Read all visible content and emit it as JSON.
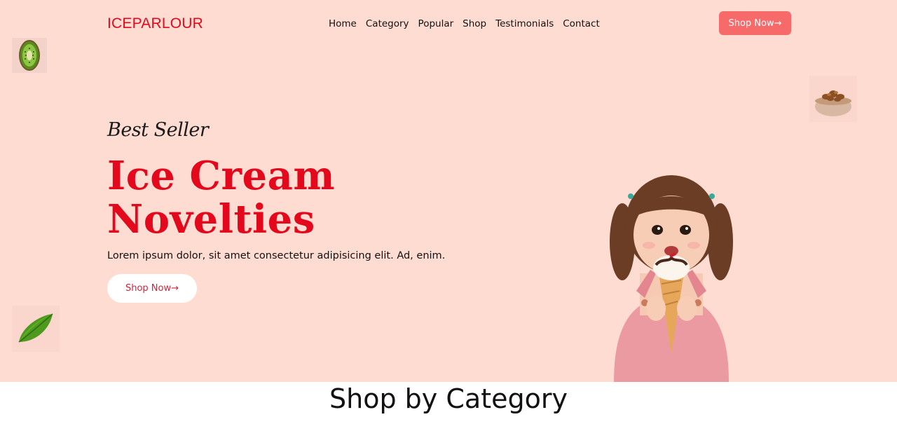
{
  "header": {
    "logo": "ICEPARLOUR",
    "nav": [
      "Home",
      "Category",
      "Popular",
      "Shop",
      "Testimonials",
      "Contact"
    ],
    "cta_label": "Shop Now",
    "cta_arrow": "→"
  },
  "hero": {
    "eyebrow": "Best Seller",
    "title_line1": "Ice Cream",
    "title_line2": "Novelties",
    "subtitle": "Lorem ipsum dolor, sit amet consectetur adipisicing elit. Ad, enim.",
    "cta_label": "Shop Now",
    "cta_arrow": "→"
  },
  "section": {
    "title": "Shop by Category"
  },
  "colors": {
    "hero_bg": "#ffdcd2",
    "brand_red": "#e3081b",
    "button_coral": "#f76a6a"
  },
  "icons": {
    "kiwi": "kiwi-slice-image",
    "nuts": "nut-bowl-image",
    "leaf": "leaf-image",
    "girl": "girl-eating-ice-cream-image"
  }
}
